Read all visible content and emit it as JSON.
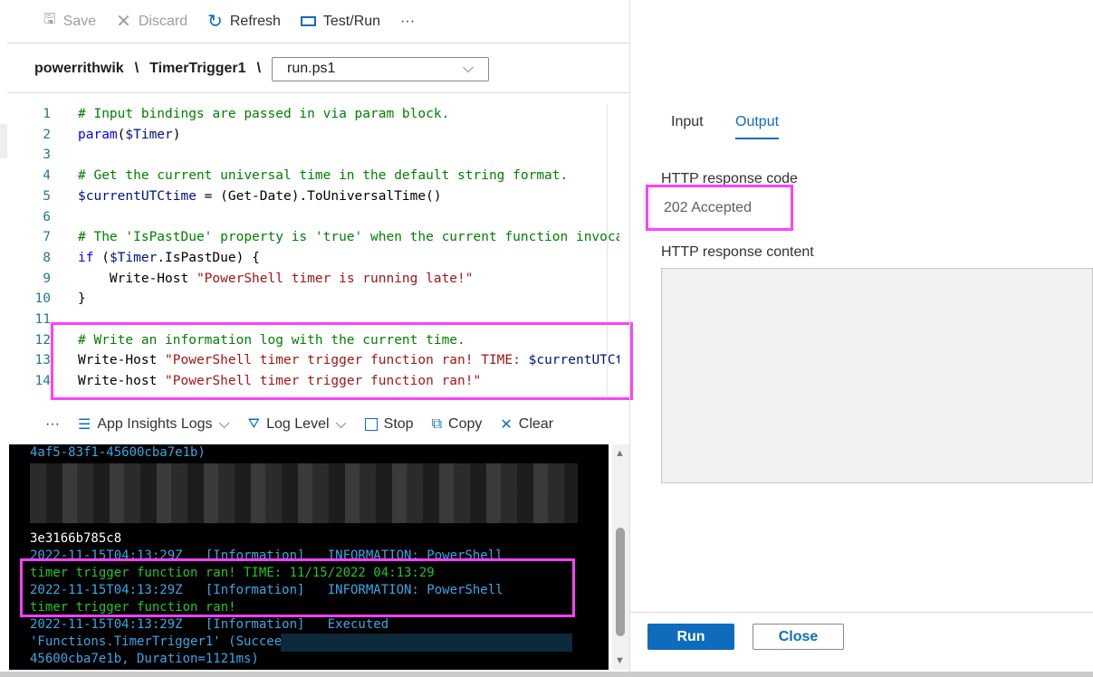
{
  "toolbar": {
    "save": "Save",
    "discard": "Discard",
    "refresh": "Refresh",
    "test_run": "Test/Run",
    "more": "···"
  },
  "breadcrumb": {
    "app": "powerrithwik",
    "sep": "\\",
    "function": "TimerTrigger1",
    "file": "run.ps1"
  },
  "editor": {
    "line_numbers": [
      "1",
      "2",
      "3",
      "4",
      "5",
      "6",
      "7",
      "8",
      "9",
      "10",
      "11",
      "12",
      "13",
      "14"
    ]
  },
  "log_toolbar": {
    "more": "···",
    "app_insights": "App Insights Logs",
    "log_level": "Log Level",
    "stop": "Stop",
    "copy": "Copy",
    "clear": "Clear"
  },
  "console": {
    "lines": [
      {
        "t": "4af5-83f1-45600cba7e1b)",
        "c": "b"
      },
      {
        "t": "",
        "c": "b"
      },
      {
        "t": "",
        "c": "b"
      },
      {
        "t": "",
        "c": "b"
      },
      {
        "t": "",
        "c": "b"
      },
      {
        "t": "3e3166b785c8",
        "c": "w"
      },
      {
        "t": "2022-11-15T04:13:29Z   [Information]   INFORMATION: PowerShell",
        "c": "b"
      },
      {
        "t": "timer trigger function ran! TIME: 11/15/2022 04:13:29",
        "c": "g"
      },
      {
        "t": "2022-11-15T04:13:29Z   [Information]   INFORMATION: PowerShell",
        "c": "b"
      },
      {
        "t": "timer trigger function ran!",
        "c": "g"
      },
      {
        "t": "2022-11-15T04:13:29Z   [Information]   Executed",
        "c": "b"
      },
      {
        "t": "'Functions.TimerTrigger1' (Succeeded, Id=",
        "c": "b"
      },
      {
        "t": "45600cba7e1b, Duration=1121ms)",
        "c": "b"
      }
    ]
  },
  "panel": {
    "tab_input": "Input",
    "tab_output": "Output",
    "code_label": "HTTP response code",
    "code_value": "202 Accepted",
    "content_label": "HTTP response content",
    "run": "Run",
    "close": "Close"
  },
  "colors": {
    "accent": "#0f6cbd",
    "highlight": "#ff40ff"
  }
}
